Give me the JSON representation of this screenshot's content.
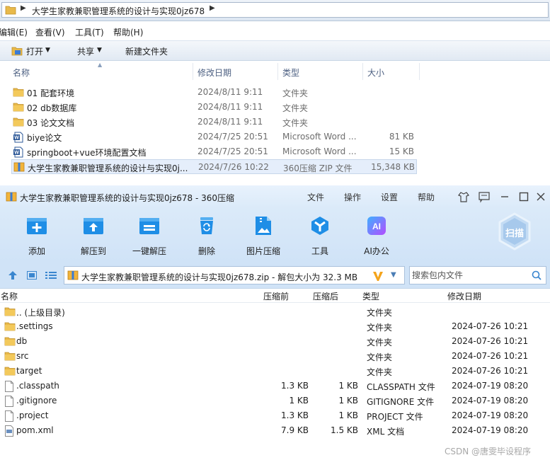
{
  "explorer": {
    "breadcrumb": [
      "大学生家教兼职管理系统的设计与实现0jz678"
    ],
    "menu": [
      "编辑(E)",
      "查看(V)",
      "工具(T)",
      "帮助(H)"
    ],
    "commands": {
      "open": "打开",
      "share": "共享",
      "new_folder": "新建文件夹"
    },
    "columns": {
      "name": "名称",
      "date": "修改日期",
      "type": "类型",
      "size": "大小"
    },
    "files": [
      {
        "name": "01 配套环境",
        "date": "2024/8/11 9:11",
        "type": "文件夹",
        "size": "",
        "icon": "folder-icon"
      },
      {
        "name": "02 db数据库",
        "date": "2024/8/11 9:11",
        "type": "文件夹",
        "size": "",
        "icon": "folder-icon"
      },
      {
        "name": "03 论文文档",
        "date": "2024/8/11 9:11",
        "type": "文件夹",
        "size": "",
        "icon": "folder-icon"
      },
      {
        "name": "biye论文",
        "date": "2024/7/25 20:51",
        "type": "Microsoft Word ...",
        "size": "81 KB",
        "icon": "word-icon"
      },
      {
        "name": "springboot+vue环境配置文档",
        "date": "2024/7/25 20:51",
        "type": "Microsoft Word ...",
        "size": "15 KB",
        "icon": "word-icon"
      },
      {
        "name": "大学生家教兼职管理系统的设计与实现0j...",
        "date": "2024/7/26 10:22",
        "type": "360压缩 ZIP 文件",
        "size": "15,348 KB",
        "icon": "zip-icon",
        "selected": true
      }
    ]
  },
  "zip": {
    "title": "大学生家教兼职管理系统的设计与实现0jz678 - 360压缩",
    "title_menu": [
      "文件",
      "操作",
      "设置",
      "帮助"
    ],
    "tools": [
      "添加",
      "解压到",
      "一键解压",
      "删除",
      "图片压缩",
      "工具",
      "AI办公"
    ],
    "scan_label": "扫描",
    "path": "大学生家教兼职管理系统的设计与实现0jz678.zip - 解包大小为 32.3 MB",
    "search_placeholder": "搜索包内文件",
    "columns": {
      "name": "名称",
      "packed": "压缩前",
      "unpacked": "压缩后",
      "type": "类型",
      "date": "修改日期"
    },
    "entries": [
      {
        "name": ".. (上级目录)",
        "packed": "",
        "unpacked": "",
        "type": "文件夹",
        "date": "",
        "icon": "folder-icon"
      },
      {
        "name": ".settings",
        "packed": "",
        "unpacked": "",
        "type": "文件夹",
        "date": "2024-07-26 10:21",
        "icon": "folder-icon"
      },
      {
        "name": "db",
        "packed": "",
        "unpacked": "",
        "type": "文件夹",
        "date": "2024-07-26 10:21",
        "icon": "folder-icon"
      },
      {
        "name": "src",
        "packed": "",
        "unpacked": "",
        "type": "文件夹",
        "date": "2024-07-26 10:21",
        "icon": "folder-icon"
      },
      {
        "name": "target",
        "packed": "",
        "unpacked": "",
        "type": "文件夹",
        "date": "2024-07-26 10:21",
        "icon": "folder-icon"
      },
      {
        "name": ".classpath",
        "packed": "1.3 KB",
        "unpacked": "1 KB",
        "type": "CLASSPATH 文件",
        "date": "2024-07-19 08:20",
        "icon": "file-icon"
      },
      {
        "name": ".gitignore",
        "packed": "1 KB",
        "unpacked": "1 KB",
        "type": "GITIGNORE 文件",
        "date": "2024-07-19 08:20",
        "icon": "file-icon"
      },
      {
        "name": ".project",
        "packed": "1.3 KB",
        "unpacked": "1 KB",
        "type": "PROJECT 文件",
        "date": "2024-07-19 08:20",
        "icon": "file-icon"
      },
      {
        "name": "pom.xml",
        "packed": "7.9 KB",
        "unpacked": "1.5 KB",
        "type": "XML 文档",
        "date": "2024-07-19 08:20",
        "icon": "xml-file-icon"
      }
    ]
  },
  "watermark": "CSDN @唐雯毕设程序"
}
